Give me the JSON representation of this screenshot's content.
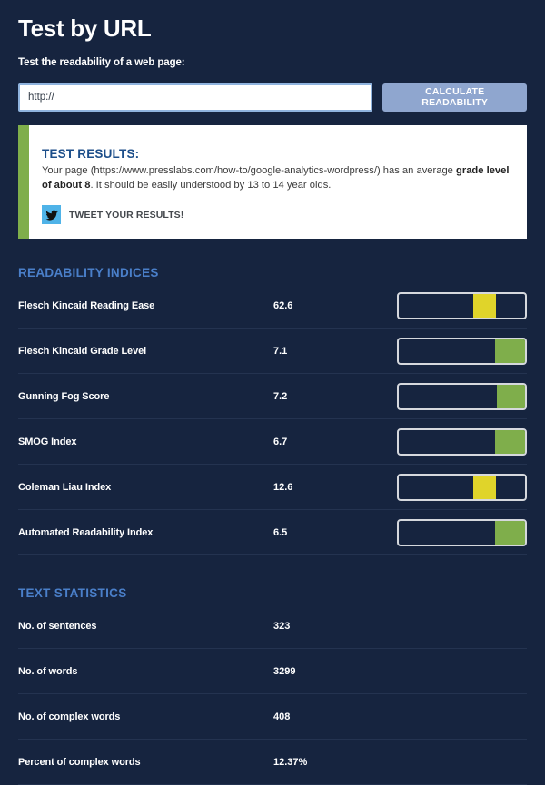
{
  "header": {
    "title": "Test by URL",
    "subtitle": "Test the readability of a web page:"
  },
  "form": {
    "url_value": "http://",
    "url_placeholder": "http://",
    "submit_label": "CALCULATE READABILITY"
  },
  "results": {
    "heading": "TEST RESULTS:",
    "text_part1": "Your page (https://www.presslabs.com/how-to/google-analytics-wordpress/) has an average ",
    "text_bold": "grade level of about 8",
    "text_part2": ". It should be easily understood by 13 to 14 year olds.",
    "tweet_label": "TWEET YOUR RESULTS!",
    "accent_color": "#7fae4b",
    "tweet_icon_color": "#4fb3e8",
    "icon": "twitter-bird-icon"
  },
  "indices": {
    "heading": "READABILITY INDICES",
    "rows": [
      {
        "label": "Flesch Kincaid Reading Ease",
        "value": "62.6",
        "gauge_start": 59,
        "gauge_width": 18,
        "gauge_color": "#e0d42a"
      },
      {
        "label": "Flesch Kincaid Grade Level",
        "value": "7.1",
        "gauge_start": 76,
        "gauge_width": 24,
        "gauge_color": "#7fae4b"
      },
      {
        "label": "Gunning Fog Score",
        "value": "7.2",
        "gauge_start": 78,
        "gauge_width": 22,
        "gauge_color": "#7fae4b"
      },
      {
        "label": "SMOG Index",
        "value": "6.7",
        "gauge_start": 76,
        "gauge_width": 24,
        "gauge_color": "#7fae4b"
      },
      {
        "label": "Coleman Liau Index",
        "value": "12.6",
        "gauge_start": 59,
        "gauge_width": 18,
        "gauge_color": "#e0d42a"
      },
      {
        "label": "Automated Readability Index",
        "value": "6.5",
        "gauge_start": 76,
        "gauge_width": 24,
        "gauge_color": "#7fae4b"
      }
    ]
  },
  "statistics": {
    "heading": "TEXT STATISTICS",
    "rows": [
      {
        "label": "No. of sentences",
        "value": "323"
      },
      {
        "label": "No. of words",
        "value": "3299"
      },
      {
        "label": "No. of complex words",
        "value": "408"
      },
      {
        "label": "Percent of complex words",
        "value": "12.37%"
      }
    ]
  },
  "colors": {
    "background": "#16243f",
    "section_heading": "#4a7fc9",
    "button": "#8fa6cf"
  }
}
